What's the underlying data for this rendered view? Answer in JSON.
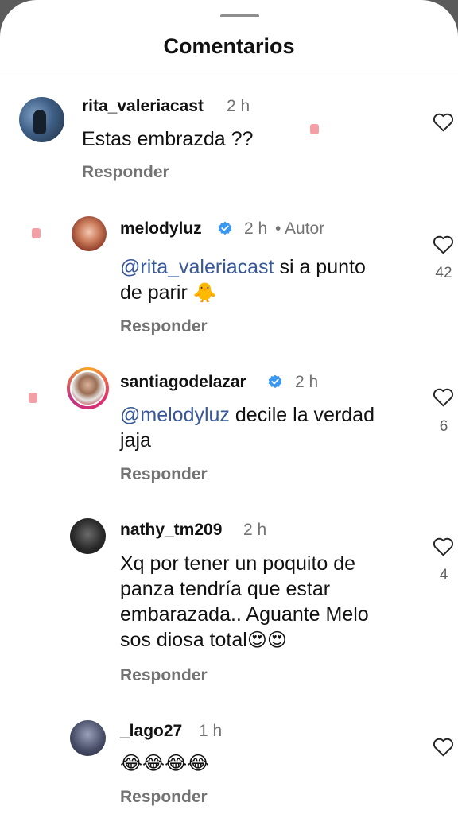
{
  "header": {
    "title": "Comentarios"
  },
  "comments": [
    {
      "username": "rita_valeriacast",
      "time": "2 h",
      "text": "Estas embrazda ??",
      "reply": "Responder",
      "likes": ""
    },
    {
      "username": "melodyluz",
      "verified": true,
      "time": "2 h",
      "author_tag": "• Autor",
      "mention": "@rita_valeriacast",
      "text_line1": " si a punto",
      "text_line2": "de parir ",
      "emoji": "🐥",
      "reply": "Responder",
      "likes": "42"
    },
    {
      "username": "santiagodelazar",
      "verified": true,
      "time": "2 h",
      "mention": "@melodyluz",
      "text_line1": " decile la verdad",
      "text_line2": "jaja",
      "reply": "Responder",
      "likes": "6"
    },
    {
      "username": "nathy_tm209",
      "time": "2 h",
      "text_lines": [
        "Xq por tener un poquito de",
        "panza tendría que estar",
        "embarazada.. Aguante Melo",
        "sos diosa total"
      ],
      "emoji": "😍😍",
      "reply": "Responder",
      "likes": "4"
    },
    {
      "username": "_lago27",
      "time": "1 h",
      "emoji": "😂😂😂😂",
      "reply": "Responder",
      "likes": ""
    }
  ],
  "colors": {
    "text": "#111111",
    "secondary": "#737373",
    "mention": "#385898",
    "verified": "#3897f0",
    "marker": "#f2a0a6"
  },
  "icons": [
    "heart-icon",
    "verified-badge-icon"
  ]
}
